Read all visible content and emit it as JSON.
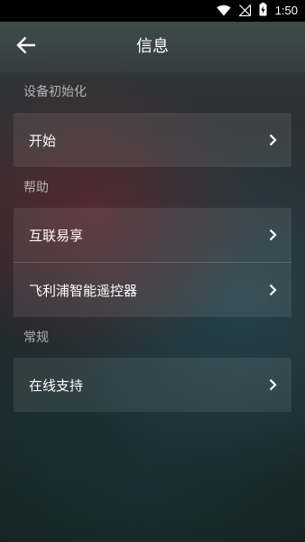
{
  "status_bar": {
    "time": "1:50",
    "icons": [
      "wifi-icon",
      "signal-icon",
      "battery-charging-icon"
    ]
  },
  "header": {
    "title": "信息",
    "back_icon": "arrow-left-icon"
  },
  "sections": [
    {
      "title": "设备初始化",
      "items": [
        {
          "label": "开始",
          "icon": "chevron-right-icon"
        }
      ]
    },
    {
      "title": "帮助",
      "items": [
        {
          "label": "互联易享",
          "icon": "chevron-right-icon"
        },
        {
          "label": "飞利浦智能遥控器",
          "icon": "chevron-right-icon"
        }
      ]
    },
    {
      "title": "常规",
      "items": [
        {
          "label": "在线支持",
          "icon": "chevron-right-icon"
        }
      ]
    }
  ],
  "colors": {
    "status_bar": "#000000",
    "text_primary": "#ffffff",
    "section_header": "#a8aeae",
    "background_top": "#3a4a48",
    "background_bottom": "#15201f"
  }
}
